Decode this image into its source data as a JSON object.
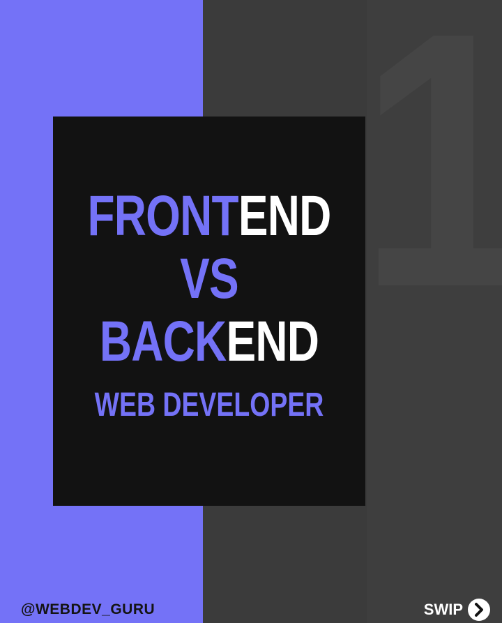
{
  "headline": {
    "line1_accent": "FRONT",
    "line1_white": "END",
    "line2_accent": "VS",
    "line3_accent": "BACK",
    "line3_white": "END"
  },
  "subtitle": "WEB DEVELOPER",
  "slide_number": "1",
  "handle": "@WEBDEV_GURU",
  "swipe_label": "SWIP",
  "icons": {
    "swipe": "chevron-right-circle-icon"
  },
  "colors": {
    "accent": "#7472f7",
    "dark_panel": "#3b3b3b",
    "card": "#121212",
    "text_white": "#ffffff"
  }
}
